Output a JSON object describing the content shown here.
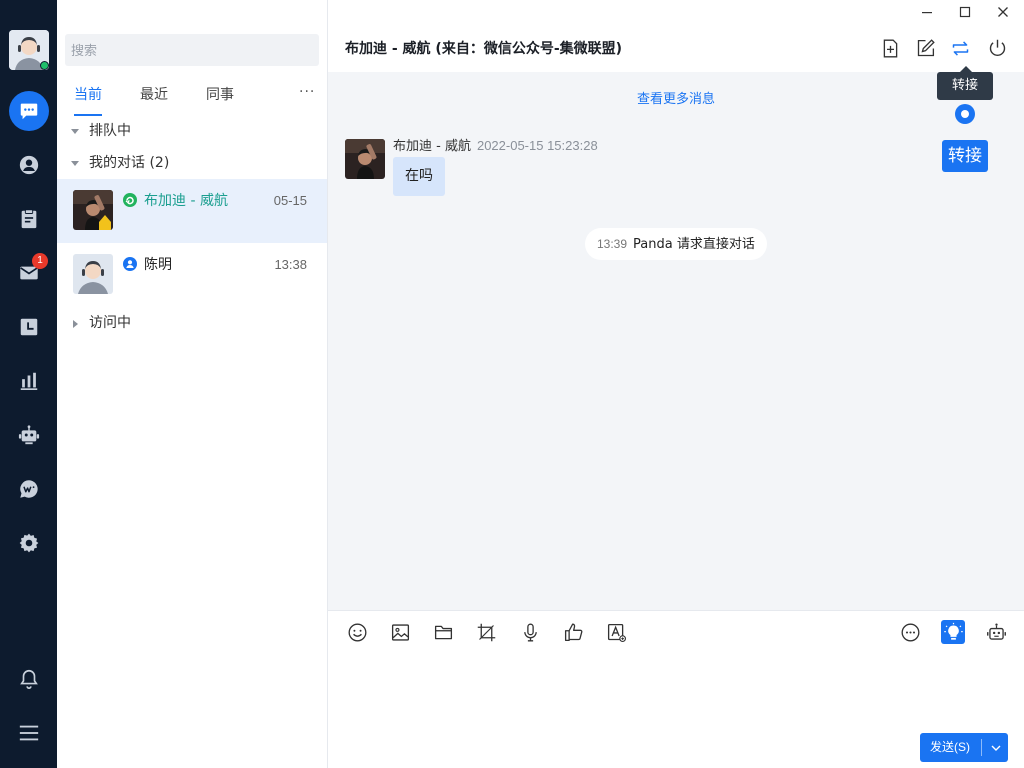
{
  "theme": {
    "accent": "#1a74f2",
    "rail_bg": "#0d1b2e",
    "online": "#1fbf6b",
    "badge": "#e8392a",
    "selected_row": "#e8f0fc"
  },
  "rail": {
    "items": [
      {
        "name": "chat",
        "icon": "chat-bubble-icon",
        "active": true
      },
      {
        "name": "customers",
        "icon": "user-circle-icon"
      },
      {
        "name": "tickets",
        "icon": "clipboard-icon"
      },
      {
        "name": "messages",
        "icon": "mail-icon",
        "badge": "1"
      },
      {
        "name": "history",
        "icon": "clock-icon"
      },
      {
        "name": "reports",
        "icon": "bar-chart-icon"
      },
      {
        "name": "robot",
        "icon": "robot-icon"
      },
      {
        "name": "wechat",
        "icon": "wechat-icon"
      },
      {
        "name": "settings",
        "icon": "gear-icon"
      },
      {
        "name": "notifications",
        "icon": "bell-icon"
      },
      {
        "name": "menu",
        "icon": "hamburger-icon"
      }
    ],
    "mail_badge": "1"
  },
  "list": {
    "search_placeholder": "搜索",
    "tabs": [
      "当前",
      "最近",
      "同事"
    ],
    "more": "···",
    "groups": {
      "queue": "排队中",
      "mine": "我的对话",
      "mine_count": "(2)",
      "visiting": "访问中"
    },
    "conversations": [
      {
        "name": "布加迪 - 威航",
        "time": "05-15",
        "channel": "wechat-channel-icon",
        "selected": true
      },
      {
        "name": "陈明",
        "time": "13:38",
        "channel": "user-channel-icon",
        "selected": false
      }
    ]
  },
  "chat": {
    "title": "布加迪 - 威航 (来自：微信公众号-集微联盟)",
    "tooltip": "转接",
    "callout": "转接",
    "load_more": "查看更多消息",
    "message": {
      "sender": "布加迪 - 威航",
      "time": "2022-05-15 15:23:28",
      "text": "在吗"
    },
    "system": {
      "time": "13:39",
      "text": "Panda 请求直接对话"
    }
  },
  "composer": {
    "send_label": "发送(S)"
  }
}
